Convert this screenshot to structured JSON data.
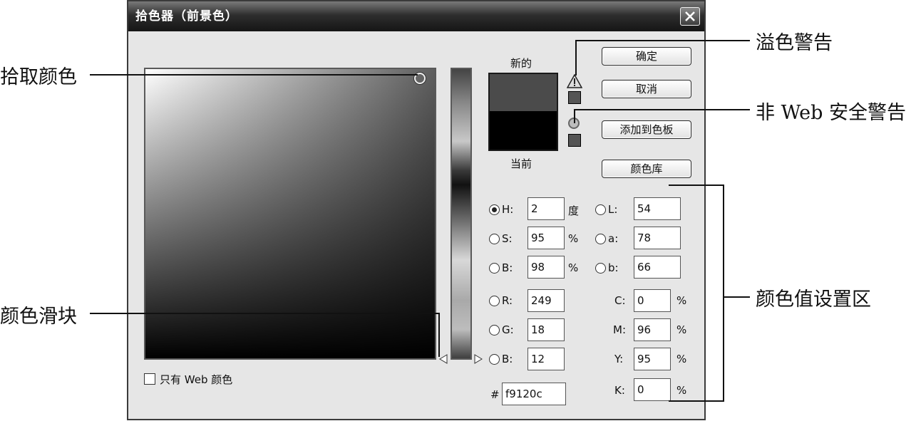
{
  "dialog": {
    "title": "拾色器（前景色）",
    "label_new": "新的",
    "label_current": "当前",
    "new_color": "#4b4b4b",
    "current_color": "#000000",
    "warn_color": "#555555",
    "web_color": "#555555",
    "buttons": {
      "ok": "确定",
      "cancel": "取消",
      "add_swatch": "添加到色板",
      "libraries": "颜色库"
    },
    "web_only_label": "只有 Web 颜色",
    "fields": {
      "H": {
        "label": "H:",
        "value": "2",
        "unit": "度",
        "selected": true
      },
      "S": {
        "label": "S:",
        "value": "95",
        "unit": "%"
      },
      "B": {
        "label": "B:",
        "value": "98",
        "unit": "%"
      },
      "R": {
        "label": "R:",
        "value": "249"
      },
      "G": {
        "label": "G:",
        "value": "18"
      },
      "Bb": {
        "label": "B:",
        "value": "12"
      },
      "L": {
        "label": "L:",
        "value": "54"
      },
      "a": {
        "label": "a:",
        "value": "78"
      },
      "lab_b": {
        "label": "b:",
        "value": "66"
      },
      "C": {
        "label": "C:",
        "value": "0",
        "unit": "%"
      },
      "M": {
        "label": "M:",
        "value": "96",
        "unit": "%"
      },
      "Y": {
        "label": "Y:",
        "value": "95",
        "unit": "%"
      },
      "K": {
        "label": "K:",
        "value": "0",
        "unit": "%"
      },
      "hex": {
        "label": "#",
        "value": "f9120c"
      }
    }
  },
  "annotations": {
    "pick_color": "拾取颜色",
    "color_slider": "颜色滑块",
    "gamut_warning": "溢色警告",
    "web_safe_warning": "非 Web 安全警告",
    "value_area": "颜色值设置区"
  }
}
